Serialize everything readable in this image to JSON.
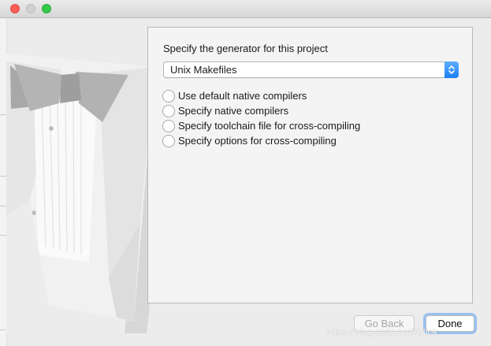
{
  "window": {
    "traffic_lights": [
      {
        "name": "close",
        "color": "#fc5f57"
      },
      {
        "name": "minimize",
        "color": "#d0d0d0"
      },
      {
        "name": "zoom",
        "color": "#35c94a"
      }
    ]
  },
  "illustration": {
    "icon": "tuxedo-bowtie-illustration"
  },
  "generator": {
    "prompt": "Specify the generator for this project",
    "selected": "Unix Makefiles",
    "accent_color": "#1c7ff0"
  },
  "compiler_options": [
    {
      "label": "Use default native compilers",
      "checked": true
    },
    {
      "label": "Specify native compilers",
      "checked": false
    },
    {
      "label": "Specify toolchain file for cross-compiling",
      "checked": false
    },
    {
      "label": "Specify options for cross-compiling",
      "checked": false
    }
  ],
  "footer": {
    "back_label": "Go Back",
    "back_enabled": false,
    "done_label": "Done"
  },
  "watermark": "https://blog.csdn.net/Artiok"
}
